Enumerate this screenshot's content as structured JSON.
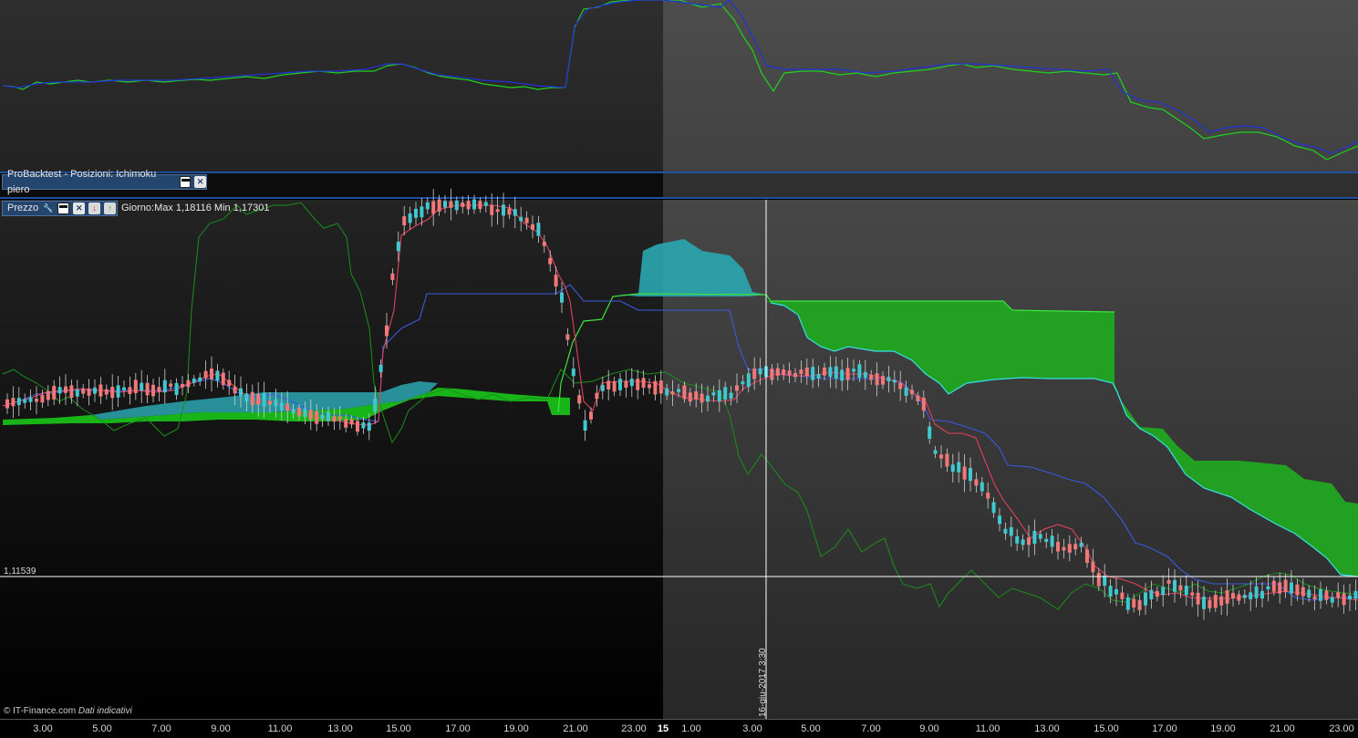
{
  "top_panel": {
    "tab_title": "ProBacktest - Posizioni: Ichimoku piero"
  },
  "price_panel": {
    "tab_title": "Prezzo",
    "readout": "Giorno:Max 1,18116 Min 1,17301",
    "crosshair_price": "1,11539",
    "crosshair_date": "16-giu-2017 3:30"
  },
  "footer": {
    "copyright": "© IT-Finance.com",
    "disclaimer": "Dati indicativi"
  },
  "x_axis": {
    "ticks": [
      "3.00",
      "5.00",
      "7.00",
      "9.00",
      "11.00",
      "13.00",
      "15.00",
      "17.00",
      "19.00",
      "21.00",
      "23.00",
      "15",
      "1.00",
      "3.00",
      "5.00",
      "7.00",
      "9.00",
      "11.00",
      "13.00",
      "15.00",
      "17.00",
      "19.00",
      "21.00",
      "23.00"
    ]
  },
  "icons": {
    "window": "window-icon",
    "close": "close-icon",
    "wrench": "wrench-icon",
    "down": "arrow-down-icon",
    "up": "arrow-up-icon"
  },
  "colors": {
    "tab_bg": "#24466e",
    "separator": "#1f4f9e",
    "kumo_bull": "#20a020",
    "kumo_bear": "#2aa6b0",
    "tenkan": "#e0405a",
    "kijun": "#3a5ae0",
    "chikou": "#1a8f1a",
    "candle_up": "#3fc8d0",
    "candle_down": "#f07878",
    "crosshair": "#ffffff"
  }
}
